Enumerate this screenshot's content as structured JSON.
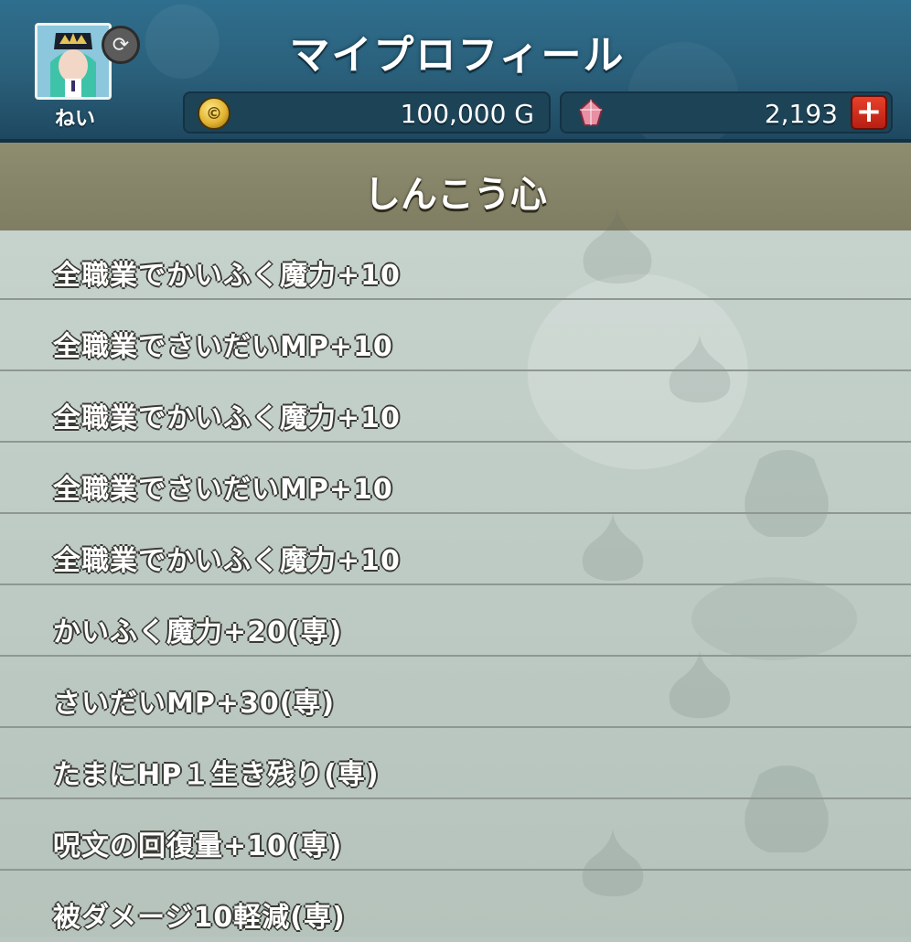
{
  "header": {
    "title": "マイプロフィール",
    "player_name": "ねい",
    "gold": {
      "value": "100,000 G",
      "icon": "gold-coin-icon",
      "symbol": "G"
    },
    "gems": {
      "value": "2,193",
      "icon": "gem-icon",
      "add_label": "+"
    }
  },
  "section": {
    "title": "しんこう心"
  },
  "list": {
    "items": [
      {
        "label": "全職業でかいふく魔力+10"
      },
      {
        "label": "全職業でさいだいMP+10"
      },
      {
        "label": "全職業でかいふく魔力+10"
      },
      {
        "label": "全職業でさいだいMP+10"
      },
      {
        "label": "全職業でかいふく魔力+10"
      },
      {
        "label": "かいふく魔力+20(専)"
      },
      {
        "label": "さいだいMP+30(専)"
      },
      {
        "label": "たまにHP１生き残り(専)"
      },
      {
        "label": "呪文の回復量+10(専)"
      },
      {
        "label": "被ダメージ10軽減(専)"
      }
    ]
  },
  "colors": {
    "header_bg": "#2a5f7a",
    "section_bg": "#8f8d70",
    "list_bg": "#bfcbc5",
    "plus_button": "#d9301c"
  }
}
